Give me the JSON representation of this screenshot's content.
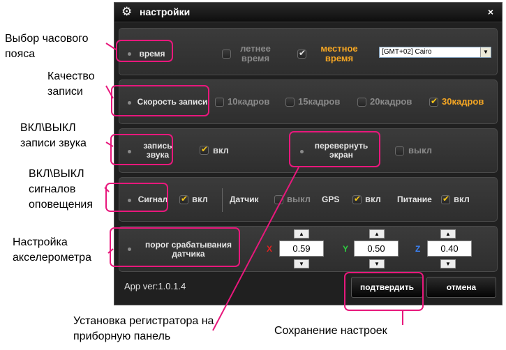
{
  "dialog": {
    "title": "настройки",
    "close": "×",
    "version": "App ver:1.0.1.4",
    "confirm_label": "подтвердить",
    "cancel_label": "отмена"
  },
  "time": {
    "label": "время",
    "summer_label": "летнее время",
    "summer_checked": false,
    "local_label": "местное время",
    "local_checked": true,
    "timezone": "[GMT+02] Cairo"
  },
  "record_speed": {
    "label": "Скорость записи",
    "options": [
      {
        "label": "10кадров",
        "checked": false
      },
      {
        "label": "15кадров",
        "checked": false
      },
      {
        "label": "20кадров",
        "checked": false
      },
      {
        "label": "30кадров",
        "checked": true
      }
    ]
  },
  "sound": {
    "label": "запись звука",
    "state_label": "вкл",
    "checked": true,
    "flip_label": "перевернуть экран",
    "flip_state_label": "выкл",
    "flip_checked": false
  },
  "signal": {
    "label": "Сигнал",
    "state_label": "вкл",
    "checked": true,
    "sensor_label": "Датчик",
    "sensor_state_label": "выкл",
    "sensor_checked": false,
    "gps_label": "GPS",
    "gps_state_label": "вкл",
    "gps_checked": true,
    "power_label": "Питание",
    "power_state_label": "вкл",
    "power_checked": true
  },
  "threshold": {
    "label": "порог срабатывания датчика",
    "x_label": "X",
    "x_value": "0.59",
    "y_label": "Y",
    "y_value": "0.50",
    "z_label": "Z",
    "z_value": "0.40"
  },
  "annotations": {
    "timezone": "Выбор часового пояса",
    "quality": "Качество записи",
    "sound": "ВКЛ\\ВЫКЛ записи звука",
    "signals": "ВКЛ\\ВЫКЛ сигналов оповещения",
    "accel": "Настройка акселерометра",
    "install": "Установка регистратора на приборную панель",
    "save": "Сохранение настроек"
  },
  "colors": {
    "accent_gold": "#f5a623",
    "annotation_pink": "#e8187c"
  }
}
